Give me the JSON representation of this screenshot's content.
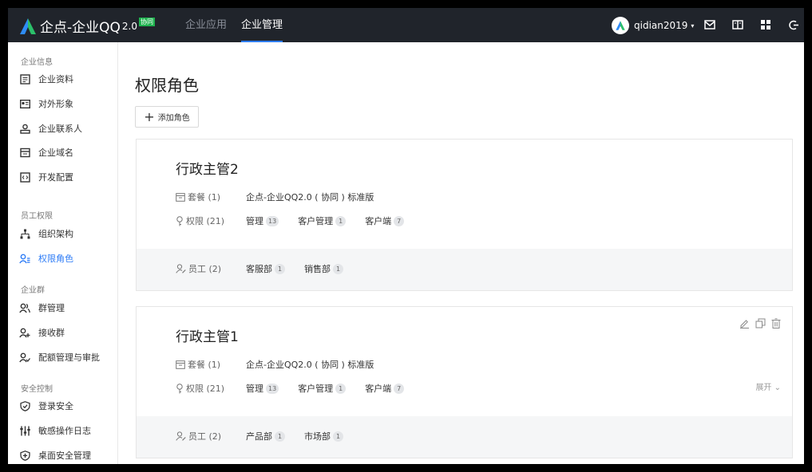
{
  "app": {
    "logo_text": "企点-企业QQ",
    "logo_version": "2.0",
    "logo_badge": "协同"
  },
  "nav": {
    "tabs": [
      {
        "label": "企业应用",
        "active": false
      },
      {
        "label": "企业管理",
        "active": true
      }
    ]
  },
  "user": {
    "name": "qidian2019",
    "caret": "▾"
  },
  "topbar_icons": [
    "mail-icon",
    "book-icon",
    "apps-grid-icon",
    "logout-icon"
  ],
  "colors": {
    "topbar": "#20242b",
    "accent": "#2e7cf6",
    "badge": "#1fb24f"
  },
  "sidebar": {
    "groups": [
      {
        "title": "企业信息",
        "items": [
          {
            "label": "企业资料",
            "icon": "document-icon"
          },
          {
            "label": "对外形象",
            "icon": "id-card-icon"
          },
          {
            "label": "企业联系人",
            "icon": "contacts-icon"
          },
          {
            "label": "企业域名",
            "icon": "domain-icon"
          },
          {
            "label": "开发配置",
            "icon": "code-icon"
          }
        ]
      },
      {
        "title": "员工权限",
        "items": [
          {
            "label": "组织架构",
            "icon": "org-chart-icon"
          },
          {
            "label": "权限角色",
            "icon": "role-icon",
            "active": true
          }
        ]
      },
      {
        "title": "企业群",
        "items": [
          {
            "label": "群管理",
            "icon": "group-icon"
          },
          {
            "label": "接收群",
            "icon": "group-add-icon"
          },
          {
            "label": "配额管理与审批",
            "icon": "group-approve-icon"
          }
        ]
      },
      {
        "title": "安全控制",
        "items": [
          {
            "label": "登录安全",
            "icon": "shield-check-icon"
          },
          {
            "label": "敏感操作日志",
            "icon": "sliders-icon"
          },
          {
            "label": "桌面安全管理",
            "icon": "shield-plus-icon"
          }
        ]
      }
    ]
  },
  "main": {
    "title": "权限角色",
    "add_button": "添加角色",
    "roles": [
      {
        "name": "行政主管2",
        "package_label": "套餐 (1)",
        "package_value": "企点-企业QQ2.0 ( 协同 ) 标准版",
        "perm_label": "权限 (21)",
        "perms": [
          {
            "name": "管理",
            "count": "13"
          },
          {
            "name": "客户管理",
            "count": "1"
          },
          {
            "name": "客户端",
            "count": "7"
          }
        ],
        "staff_label": "员工 (2)",
        "depts": [
          {
            "name": "客服部",
            "count": "1"
          },
          {
            "name": "销售部",
            "count": "1"
          }
        ]
      },
      {
        "name": "行政主管1",
        "package_label": "套餐 (1)",
        "package_value": "企点-企业QQ2.0 ( 协同 ) 标准版",
        "perm_label": "权限 (21)",
        "perms": [
          {
            "name": "管理",
            "count": "13"
          },
          {
            "name": "客户管理",
            "count": "1"
          },
          {
            "name": "客户端",
            "count": "7"
          }
        ],
        "staff_label": "员工 (2)",
        "depts": [
          {
            "name": "产品部",
            "count": "1"
          },
          {
            "name": "市场部",
            "count": "1"
          }
        ],
        "expand_label": "展开 ⌄"
      }
    ]
  }
}
